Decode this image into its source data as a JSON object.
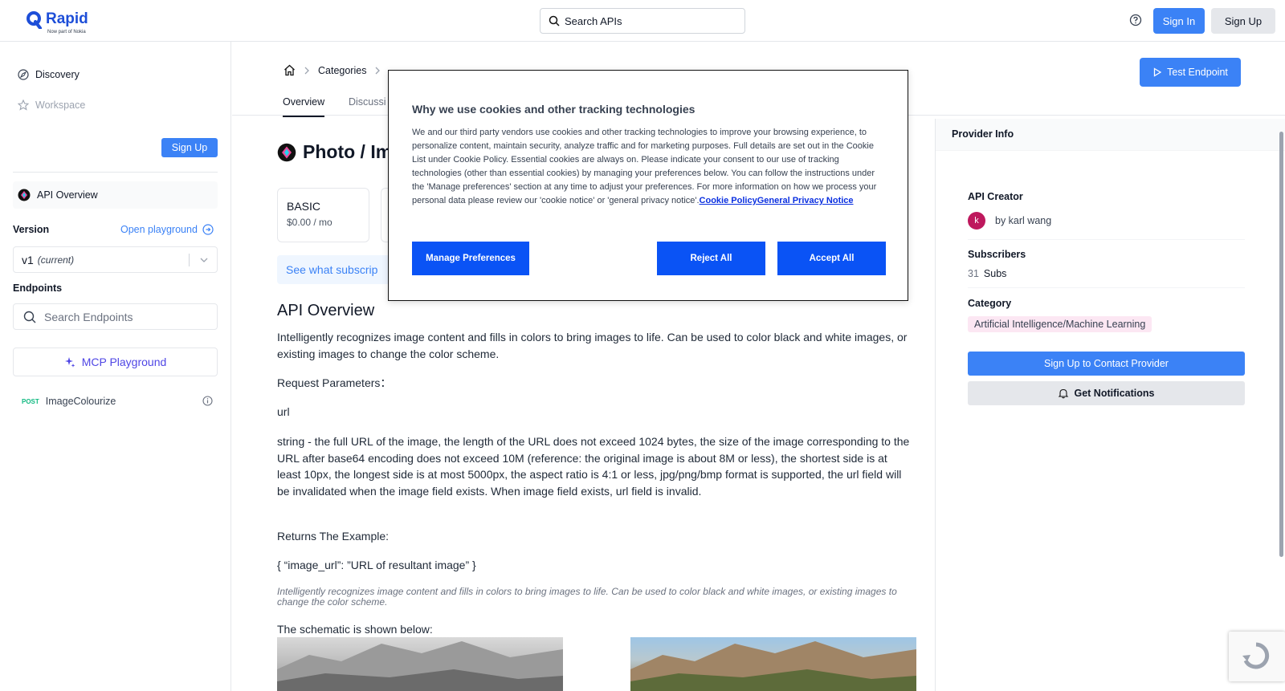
{
  "header": {
    "brand": "Rapid",
    "brand_sub": "Now part of Nokia",
    "search_placeholder": "Search APIs",
    "signin_label": "Sign In",
    "signup_label": "Sign Up"
  },
  "sidebar": {
    "discovery": "Discovery",
    "workspace": "Workspace",
    "signup_label": "Sign Up",
    "api_overview": "API Overview",
    "version_label": "Version",
    "open_playground": "Open playground",
    "version_value": "v1",
    "version_current": "(current)",
    "endpoints_label": "Endpoints",
    "endpoints_search_placeholder": "Search Endpoints",
    "mcp_label": "MCP Playground",
    "endpoint": {
      "method": "POST",
      "name": "ImageColourize"
    }
  },
  "breadcrumb": {
    "categories": "Categories"
  },
  "test_endpoint_label": "Test Endpoint",
  "tabs": {
    "overview": "Overview",
    "discussions": "Discussi"
  },
  "content": {
    "title": "Photo / Im",
    "plan": {
      "name": "BASIC",
      "price": "$0.00 / mo"
    },
    "subs_banner": "See what subscrip",
    "overview_heading": "API Overview",
    "p1": "Intelligently recognizes image content and fills in colors to bring images to life. Can be used to color black and white images, or existing images to change the color scheme.",
    "p2": "Request Parameters：",
    "p3": "url",
    "p4": "string - the full URL of the image, the length of the URL does not exceed 1024 bytes, the size of the image corresponding to the URL after base64 encoding does not exceed 10M (reference: the original image is about 8M or less), the shortest side is at least 10px, the longest side is at most 5000px, the aspect ratio is 4:1 or less, jpg/png/bmp format is supported, the url field will be invalidated when the image field exists. When image field exists, url field is invalid.",
    "p5": "Returns The Example:",
    "p6": "{ “image_url”: ”URL of resultant image” }",
    "caption": "Intelligently recognizes image content and fills in colors to bring images to life. Can be used to color black and white images, or existing images to change the color scheme.",
    "p7": "The schematic is shown below:"
  },
  "provider": {
    "heading": "Provider Info",
    "creator_label": "API Creator",
    "avatar_letter": "k",
    "creator_name": "by karl wang",
    "subscribers_label": "Subscribers",
    "subs_count": "31",
    "subs_unit": "Subs",
    "category_label": "Category",
    "category_value": "Artificial Intelligence/Machine Learning",
    "contact_label": "Sign Up to Contact Provider",
    "notif_label": "Get Notifications"
  },
  "cookie_modal": {
    "title": "Why we use cookies and other tracking technologies",
    "body": "We and our third party vendors use cookies and other tracking technologies to improve your browsing experience, to personalize content, maintain security, analyze traffic and for marketing purposes. Full details are set out in the Cookie List under Cookie Policy. Essential cookies are always on. Please indicate your consent to our use of tracking technologies (other than essential cookies) by managing your preferences below. You can follow the instructions under the 'Manage preferences' section at any time to adjust your preferences. For more information on how we process your personal data please review our 'cookie notice' or 'general privacy notice'.",
    "link1": "Cookie Policy",
    "link2": "General Privacy Notice",
    "manage_label": "Manage Preferences",
    "reject_label": "Reject All",
    "accept_label": "Accept All"
  },
  "colors": {
    "accent": "#3b82f6",
    "cookie_button": "#0a53f5",
    "mcp": "#4f46e5"
  }
}
